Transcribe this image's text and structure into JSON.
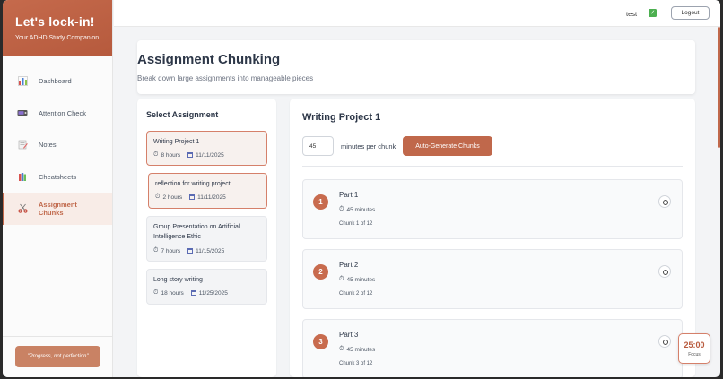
{
  "sidebar": {
    "brand_title": "Let's lock-in!",
    "brand_subtitle": "Your ADHD Study Companion",
    "items": [
      {
        "label": "Dashboard",
        "icon": "bar-chart-icon",
        "active": false
      },
      {
        "label": "Attention Check",
        "icon": "video-camera-icon",
        "active": false
      },
      {
        "label": "Notes",
        "icon": "memo-icon",
        "active": false
      },
      {
        "label": "Cheatsheets",
        "icon": "books-icon",
        "active": false
      },
      {
        "label": "Assignment Chunks",
        "icon": "scissors-icon",
        "active": true
      }
    ],
    "quote": "\"Progress, not perfection\""
  },
  "topbar": {
    "username": "test",
    "logout_label": "Logout"
  },
  "header": {
    "title": "Assignment Chunking",
    "subtitle": "Break down large assignments into manageable pieces"
  },
  "select_panel": {
    "title": "Select Assignment",
    "assignments": [
      {
        "name": "Writing Project 1",
        "hours": "8 hours",
        "date": "11/11/2025",
        "selected": true
      },
      {
        "name": "reflection for writing project",
        "hours": "2 hours",
        "date": "11/11/2025",
        "selected": true
      },
      {
        "name": "Group Presentation on Artificial Intelligence Ethic",
        "hours": "7 hours",
        "date": "11/15/2025",
        "selected": false
      },
      {
        "name": "Long story writing",
        "hours": "18 hours",
        "date": "11/25/2025",
        "selected": false
      }
    ]
  },
  "work_panel": {
    "title": "Writing Project 1",
    "minutes_value": "45",
    "minutes_label": "minutes per chunk",
    "auto_button": "Auto-Generate Chunks",
    "chunks": [
      {
        "number": "1",
        "title": "Part 1",
        "duration": "45 minutes",
        "of_label": "Chunk 1 of 12"
      },
      {
        "number": "2",
        "title": "Part 2",
        "duration": "45 minutes",
        "of_label": "Chunk 2 of 12"
      },
      {
        "number": "3",
        "title": "Part 3",
        "duration": "45 minutes",
        "of_label": "Chunk 3 of 12"
      }
    ]
  },
  "timer": {
    "value": "25:00",
    "label": "Focus"
  },
  "colors": {
    "accent": "#c0684b",
    "brand_gradient_start": "#c56a4c",
    "check_green": "#4caf50"
  }
}
